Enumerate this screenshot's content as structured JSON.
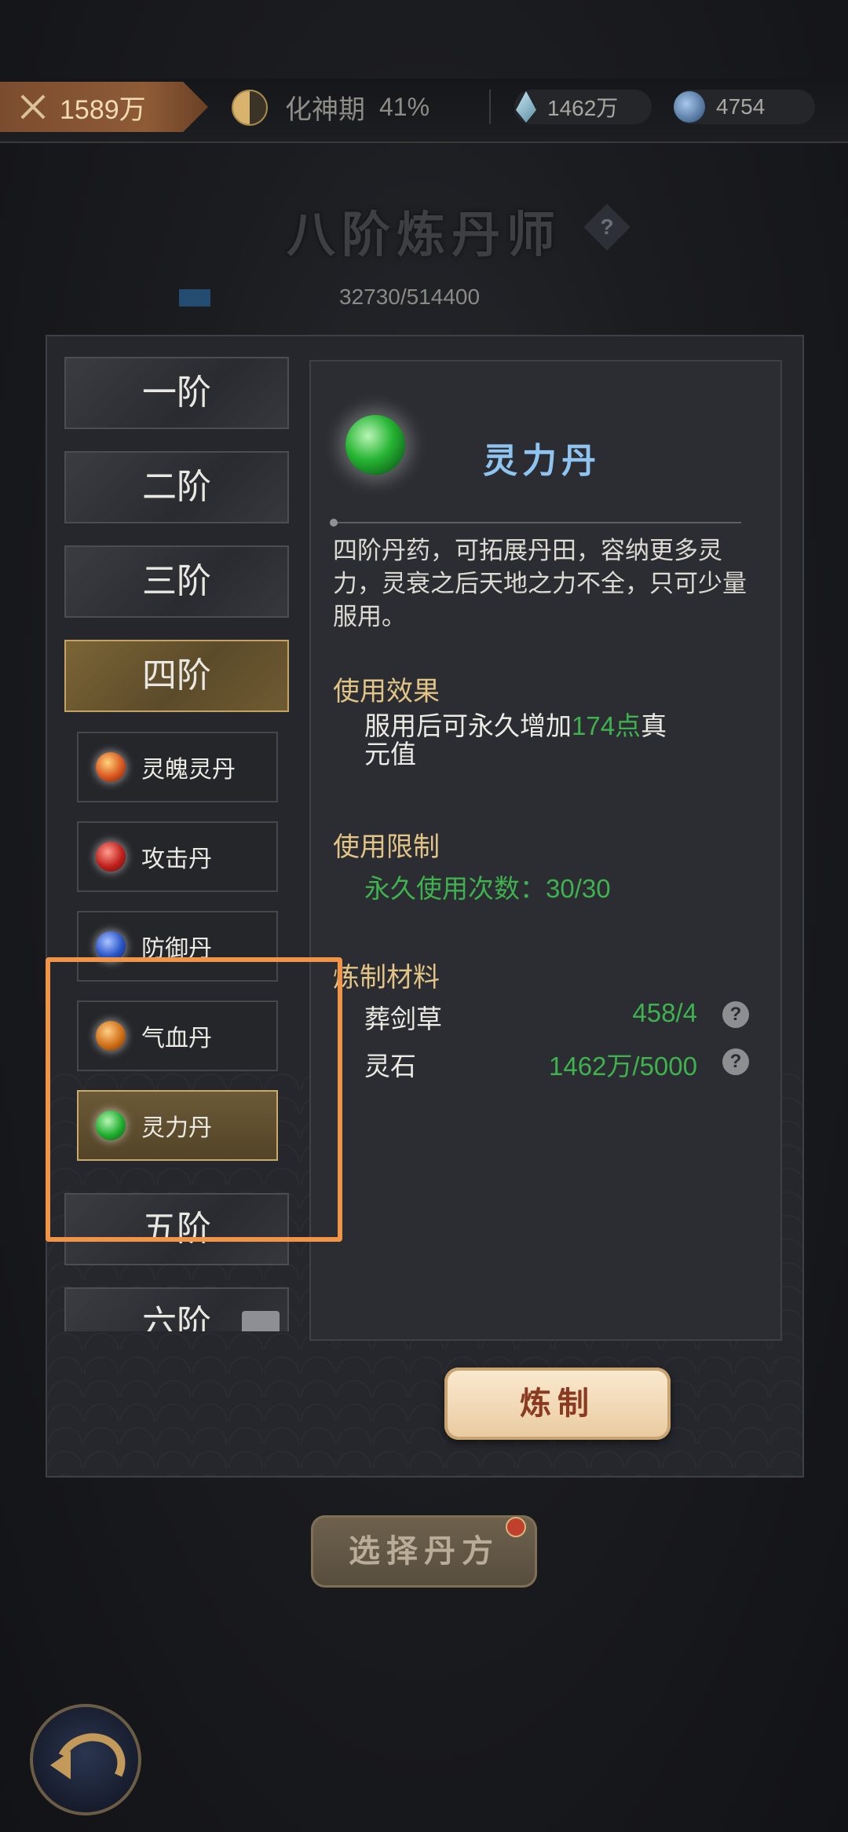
{
  "status_bar": {
    "power": "1589万",
    "realm_name": "化神期",
    "realm_progress": "41%",
    "spirit_crystal": "1462万",
    "jade": "4754"
  },
  "title": "八阶炼丹师",
  "help_symbol": "?",
  "experience": "32730/514400",
  "tiers": {
    "t1": "一阶",
    "t2": "二阶",
    "t3": "三阶",
    "t4": "四阶",
    "t5": "五阶",
    "t6": "六阶"
  },
  "pills": [
    {
      "label": "灵魄灵丹",
      "color": "#d9571f"
    },
    {
      "label": "攻击丹",
      "color": "#c0201c"
    },
    {
      "label": "防御丹",
      "color": "#2a55c7"
    },
    {
      "label": "气血丹",
      "color": "#cf6f17"
    },
    {
      "label": "灵力丹",
      "color": "#1fae2e"
    }
  ],
  "detail": {
    "name": "灵力丹",
    "description": "四阶丹药，可拓展丹田，容纳更多灵力，灵衰之后天地之力不全，只可少量服用。",
    "effect_title": "使用效果",
    "effect_prefix": "服用后可永久增加",
    "effect_value": "174点",
    "effect_suffix_1": "真",
    "effect_suffix_2": "元值",
    "limit_title": "使用限制",
    "limit_text": "永久使用次数：30/30",
    "materials_title": "炼制材料",
    "materials": [
      {
        "name": "葬剑草",
        "amount": "458/4"
      },
      {
        "name": "灵石",
        "amount": "1462万/5000"
      }
    ]
  },
  "buttons": {
    "craft": "炼制",
    "choose_recipe": "选择丹方"
  },
  "colors": {
    "accent_gold": "#e2c586",
    "value_green": "#3fb24f",
    "title_blue": "#8ec4ef",
    "highlight_orange": "#f0944a"
  }
}
